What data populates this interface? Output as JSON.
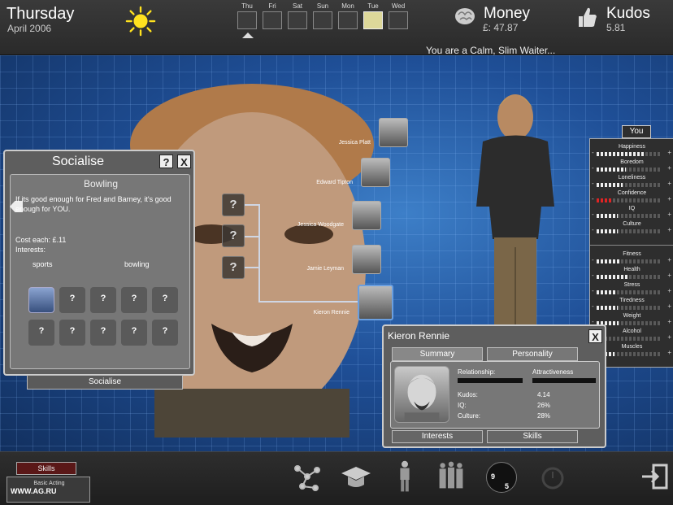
{
  "header": {
    "day": "Thursday",
    "date": "April 2006",
    "weather_icon": "sun-icon",
    "week_days": [
      "Thu",
      "Fri",
      "Sat",
      "Sun",
      "Mon",
      "Tue",
      "Wed"
    ],
    "highlight_index": 5,
    "money_label": "Money",
    "money_value": "£: 47.87",
    "kudos_label": "Kudos",
    "kudos_value": "5.81",
    "status_text": "You are a Calm, Slim Waiter..."
  },
  "contacts": [
    {
      "name": "Jessica Platt"
    },
    {
      "name": "Edward Tipton"
    },
    {
      "name": "Jessica Woodgate"
    },
    {
      "name": "Jamie Leyman"
    },
    {
      "name": "Kieron Rennie"
    }
  ],
  "unknown_slots": [
    "?",
    "?",
    "?"
  ],
  "socialise": {
    "title": "Socialise",
    "help_label": "?",
    "close_label": "X",
    "activity": "Bowling",
    "description": "If its good enough for Fred and Barney, it's good enough for YOU.",
    "cost": "Cost each:   £.11",
    "interests_label": "Interests:",
    "interests": [
      "sports",
      "bowling"
    ],
    "slot_mark": "?",
    "button": "Socialise"
  },
  "stats": {
    "tab": "You",
    "items": [
      {
        "name": "Happiness",
        "level": 0.72,
        "warn": false
      },
      {
        "name": "Boredom",
        "level": 0.45,
        "warn": false
      },
      {
        "name": "Loneliness",
        "level": 0.4,
        "warn": false
      },
      {
        "name": "Confidence",
        "level": 0.22,
        "warn": true
      },
      {
        "name": "IQ",
        "level": 0.32,
        "warn": false
      },
      {
        "name": "Culture",
        "level": 0.33,
        "warn": false
      },
      {
        "name": "Fitness",
        "level": 0.38,
        "warn": false
      },
      {
        "name": "Health",
        "level": 0.48,
        "warn": false
      },
      {
        "name": "Stress",
        "level": 0.3,
        "warn": false
      },
      {
        "name": "Tiredness",
        "level": 0.32,
        "warn": false
      },
      {
        "name": "Weight",
        "level": 0.34,
        "warn": false
      },
      {
        "name": "Alcohol",
        "level": 0.06,
        "warn": false
      },
      {
        "name": "Muscles",
        "level": 0.28,
        "warn": false
      }
    ]
  },
  "kieron": {
    "name": "Kieron Rennie",
    "close_label": "X",
    "tabs": [
      "Summary",
      "Personality"
    ],
    "relationship_label": "Relationship:",
    "attractiveness_label": "Attractiveness",
    "kudos_label": "Kudos:",
    "kudos_value": "4.14",
    "iq_label": "IQ:",
    "iq_value": "26%",
    "culture_label": "Culture:",
    "culture_value": "28%",
    "buttons": [
      "Interests",
      "Skills"
    ]
  },
  "bottom": {
    "skills_tab": "Skills",
    "basic_acting": "Basic Acting",
    "watermark": "WWW.AG.RU",
    "clock_left": "9",
    "clock_right": "5",
    "icons": [
      "network-icon",
      "graduation-cap-icon",
      "person-icon",
      "group-icon",
      "clock-icon",
      "disabled-clock-icon",
      "exit-icon"
    ]
  }
}
